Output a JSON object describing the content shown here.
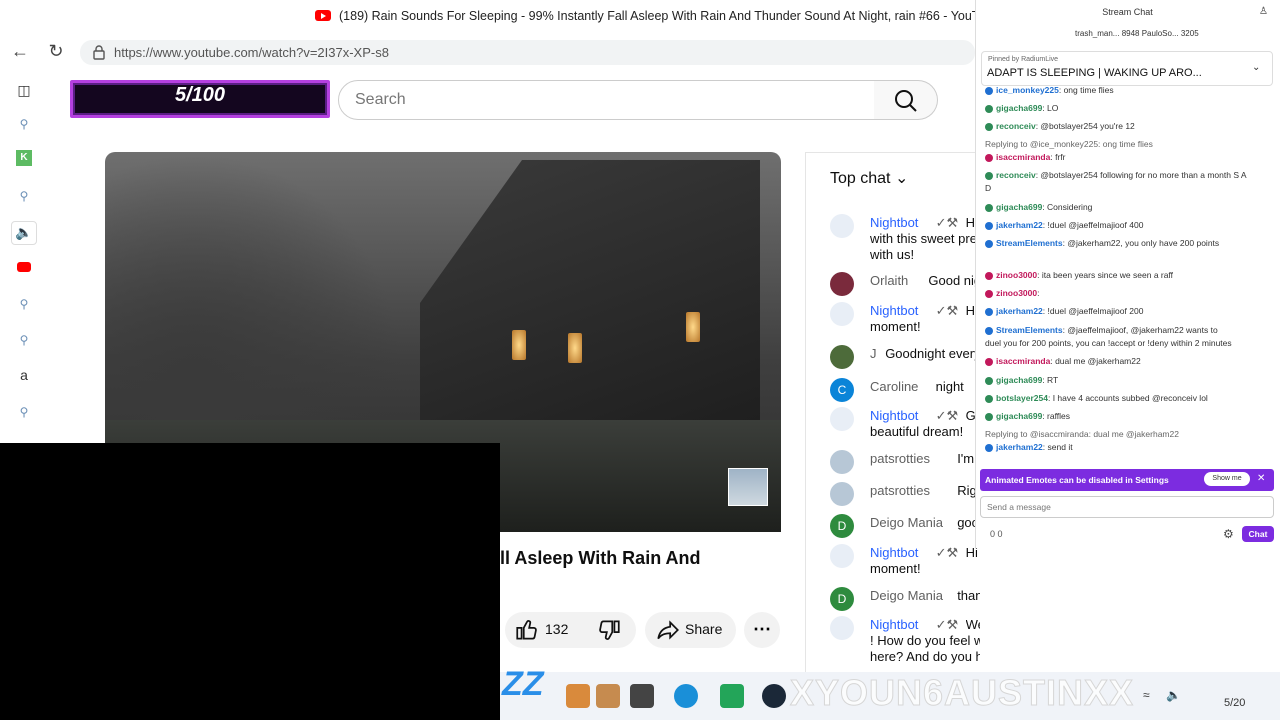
{
  "browser": {
    "window_title": "(189) Rain Sounds For Sleeping - 99% Instantly Fall Asleep With Rain And Thunder Sound At Night, rain #66 - YouTube",
    "url": "https://www.youtube.com/watch?v=2I37x-XP-s8"
  },
  "overlay": {
    "counter": "5/100"
  },
  "youtube": {
    "search_placeholder": "Search",
    "video_title_visible": "ll Asleep With Rain And",
    "like_count": "132",
    "share_label": "Share"
  },
  "live_chat": {
    "header": "Top chat",
    "messages": [
      {
        "name": "Nightbot",
        "text": "Hi",
        "text2": "with this sweet pre",
        "text3": "with us!",
        "color": "#2962ff"
      },
      {
        "name": "Orlaith",
        "text": "Good nigh",
        "color": "#606060"
      },
      {
        "name": "Nightbot",
        "text": "Hi",
        "text2": "moment!",
        "color": "#2962ff"
      },
      {
        "name": "J",
        "text": "Goodnight every",
        "color": "#606060"
      },
      {
        "name": "Caroline",
        "text": "night",
        "color": "#606060",
        "initial": "C"
      },
      {
        "name": "Nightbot",
        "text": "Go",
        "text2": "beautiful dream!",
        "color": "#2962ff"
      },
      {
        "name": "patsrotties",
        "text": "I'm ba",
        "color": "#606060"
      },
      {
        "name": "patsrotties",
        "text": "Right",
        "color": "#606060"
      },
      {
        "name": "Deigo Mania",
        "text": "good",
        "color": "#606060",
        "initial": "D"
      },
      {
        "name": "Nightbot",
        "text": "Hi Deigo Mania , Have a best relax",
        "text2": "moment!",
        "color": "#2962ff"
      },
      {
        "name": "Deigo Mania",
        "text": "thanks",
        "color": "#606060",
        "initial": "D"
      },
      {
        "name": "Nightbot",
        "text": "Welcome to the Rain Sound Natural",
        "text2": "! How do you feel when hearing the sound of rain",
        "text3": "here? And do you have any suggestions to make",
        "color": "#2962ff"
      }
    ]
  },
  "stream_chat": {
    "title": "Stream Chat",
    "top_users": "trash_man...  8948   PauloSo...  3205",
    "pinned_by": "Pinned by  RadiumLive",
    "pinned_text": "ADAPT IS SLEEPING  | WAKING UP ARO...",
    "lines": [
      {
        "user": "ice_monkey225",
        "text": ": ong time flies",
        "color": "#1f6fd1"
      },
      {
        "user": "gigacha699",
        "text": ": LO",
        "color": "#2e8b57"
      },
      {
        "user": "reconceiv",
        "text": ": @botslayer254 you're 12",
        "color": "#2e8b57"
      },
      {
        "user": "",
        "text": "Replying to @ice_monkey225: ong time flies",
        "color": "#666"
      },
      {
        "user": "isaccmiranda",
        "text": ": frfr",
        "color": "#c2185b"
      },
      {
        "user": "reconceiv",
        "text": ": @botslayer254 following for no more than a month S A",
        "color": "#2e8b57"
      },
      {
        "user": "",
        "text": "D",
        "color": "#333"
      },
      {
        "user": "gigacha699",
        "text": ": Considering",
        "color": "#2e8b57"
      },
      {
        "user": "jakerham22",
        "text": ": !duel @jaeffelmajioof 400",
        "color": "#1f6fd1"
      },
      {
        "user": "StreamElements",
        "text": ": @jakerham22, you only have 200 points",
        "color": "#1f6fd1"
      },
      {
        "user": "zinoo3000",
        "text": ": ita been years since we seen a raff",
        "color": "#c2185b"
      },
      {
        "user": "zinoo3000",
        "text": ":",
        "color": "#c2185b"
      },
      {
        "user": "jakerham22",
        "text": ": !duel @jaeffelmajioof 200",
        "color": "#1f6fd1"
      },
      {
        "user": "StreamElements",
        "text": ": @jaeffelmajioof, @jakerham22 wants to",
        "color": "#1f6fd1"
      },
      {
        "user": "",
        "text": "duel you for 200 points, you can !accept or !deny within 2 minutes",
        "color": "#333"
      },
      {
        "user": "isaccmiranda",
        "text": ": dual me @jakerham22",
        "color": "#c2185b"
      },
      {
        "user": "gigacha699",
        "text": ": RT",
        "color": "#2e8b57"
      },
      {
        "user": "botslayer254",
        "text": ": I have 4 accounts subbed @reconceiv lol",
        "color": "#2e8b57"
      },
      {
        "user": "gigacha699",
        "text": ": raffles",
        "color": "#2e8b57"
      },
      {
        "user": "",
        "text": "Replying to @isaccmiranda: dual me @jakerham22",
        "color": "#666"
      },
      {
        "user": "jakerham22",
        "text": ": send it",
        "color": "#1f6fd1"
      }
    ],
    "banner_text": "Animated Emotes can be disabled in Settings",
    "show_me": "Show me",
    "input_placeholder": "Send a message",
    "points": "0   0",
    "chat_button": "Chat"
  },
  "taskbar": {
    "watermark": "XYOUN6AUSTINXX",
    "date": "5/20"
  }
}
